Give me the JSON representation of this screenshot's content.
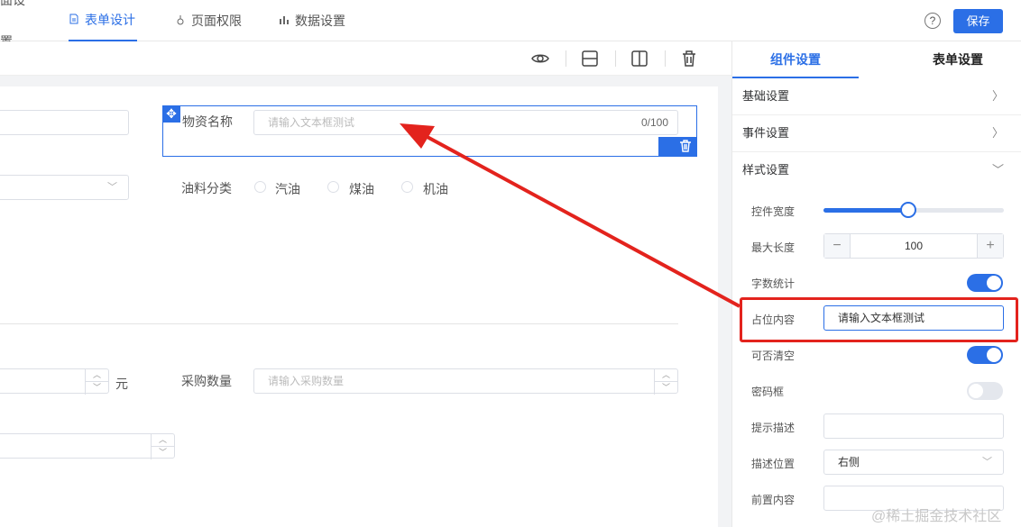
{
  "header": {
    "tabs": [
      {
        "label": "面设置",
        "icon": "page-icon"
      },
      {
        "label": "表单设计",
        "icon": "document-icon"
      },
      {
        "label": "页面权限",
        "icon": "lock-icon"
      },
      {
        "label": "数据设置",
        "icon": "bar-chart-icon"
      }
    ],
    "active_tab": "表单设计",
    "help_label": "?",
    "save_label": "保存"
  },
  "toolbar": {
    "tools": [
      "eye-icon",
      "row-layout-icon",
      "column-layout-icon",
      "trash-icon"
    ]
  },
  "form": {
    "material_name": {
      "label": "物资名称",
      "placeholder": "请输入文本框测试",
      "count": "0/100"
    },
    "oil_category": {
      "label": "油料分类",
      "options": [
        "汽油",
        "煤油",
        "机油"
      ]
    },
    "price_unit": "元",
    "purchase_qty": {
      "label": "采购数量",
      "placeholder": "请输入采购数量"
    }
  },
  "panel": {
    "tabs": [
      "组件设置",
      "表单设置"
    ],
    "active_tab": "组件设置",
    "sections": {
      "basic": "基础设置",
      "event": "事件设置",
      "style": "样式设置"
    },
    "fields": {
      "width_label": "控件宽度",
      "width_value": 0.47,
      "maxlen_label": "最大长度",
      "maxlen_value": "100",
      "minus": "−",
      "plus": "+",
      "wordcount_label": "字数统计",
      "placeholder_label": "占位内容",
      "placeholder_value": "请输入文本框测试",
      "clearable_label": "可否清空",
      "password_label": "密码框",
      "hint_label": "提示描述",
      "hint_pos_label": "描述位置",
      "hint_pos_value": "右侧",
      "prefix_label": "前置内容"
    },
    "toggles": {
      "wordcount": true,
      "clearable": true,
      "password": false
    }
  },
  "colors": {
    "primary": "#2b6fe6",
    "annotation": "#e3231d"
  },
  "watermark": "@稀土掘金技术社区"
}
